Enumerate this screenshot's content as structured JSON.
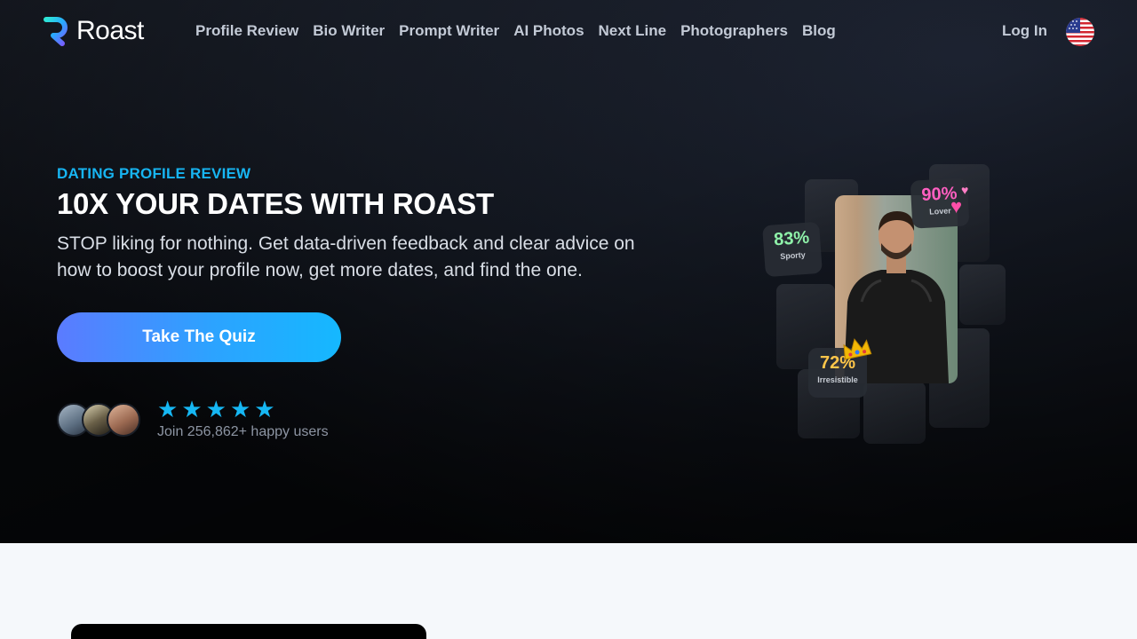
{
  "brand": {
    "name": "Roast"
  },
  "nav": {
    "links": [
      "Profile Review",
      "Bio Writer",
      "Prompt Writer",
      "AI Photos",
      "Next Line",
      "Photographers",
      "Blog"
    ],
    "login": "Log In",
    "language_flag": "us-flag-icon"
  },
  "hero": {
    "eyebrow": "DATING PROFILE REVIEW",
    "headline": "10X YOUR DATES WITH ROAST",
    "subtext": "STOP liking for nothing. Get data-driven feedback and clear advice on how to boost your profile now, get more dates, and find the one.",
    "cta": "Take The Quiz",
    "rating": 5,
    "social_proof": "Join 256,862+ happy users"
  },
  "collage": {
    "badges": [
      {
        "value": "83%",
        "label": "Sporty",
        "color": "#8ef0a8"
      },
      {
        "value": "90%",
        "label": "Lover",
        "color": "#ff5fc1"
      },
      {
        "value": "72%",
        "label": "Irresistible",
        "color": "#ffc64a"
      }
    ]
  },
  "colors": {
    "accent": "#17b5f2",
    "cta_gradient_start": "#5b7bff",
    "cta_gradient_end": "#15b8ff",
    "hero_bg": "#0b0e13",
    "page_bg": "#f5f8fb"
  }
}
